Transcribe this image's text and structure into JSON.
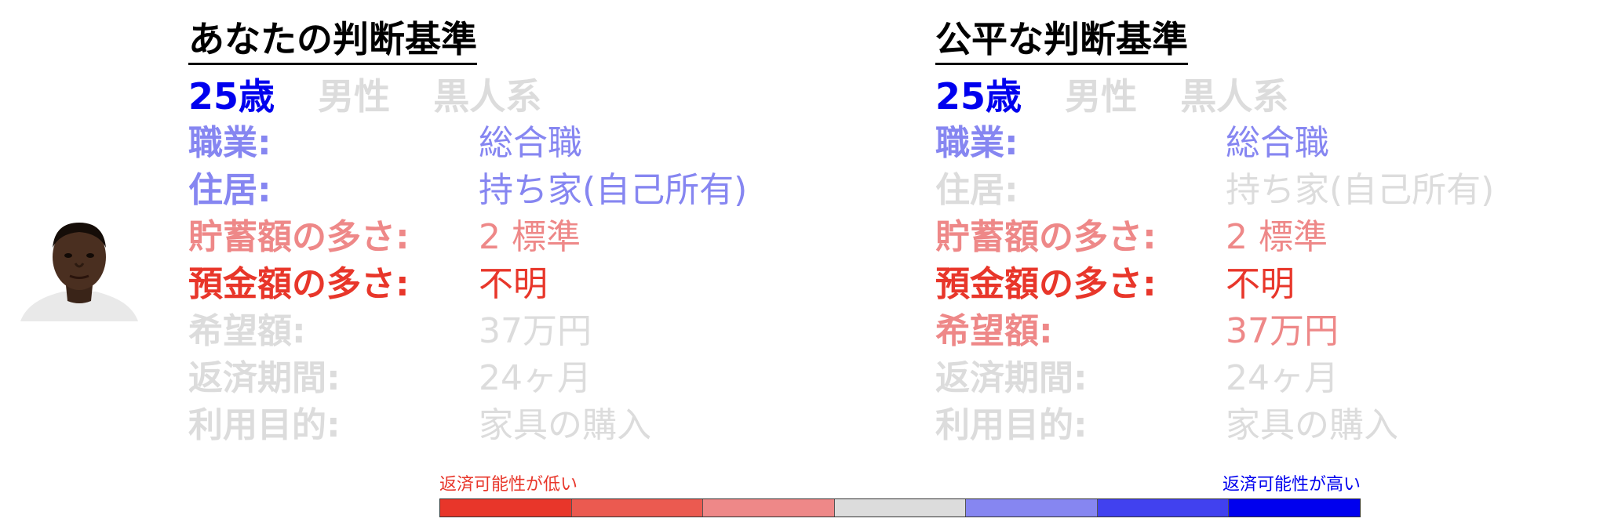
{
  "colors": {
    "level_high": "#0000ee",
    "level_mid_high": "#8686f1",
    "neutral": "#dcdcdc",
    "level_low_mid": "#ee8888",
    "level_low": "#e8362a",
    "heading": "#000000"
  },
  "avatar_icon": "person-photo-icon",
  "panels": [
    {
      "heading": "あなたの判断基準",
      "demographics": [
        {
          "text": "25歳",
          "color": "#0000ee"
        },
        {
          "text": "男性",
          "color": "#dcdcdc"
        },
        {
          "text": "黒人系",
          "color": "#dcdcdc"
        }
      ],
      "rows": [
        {
          "label": "職業:",
          "value": "総合職",
          "color": "#8686f1"
        },
        {
          "label": "住居:",
          "value": "持ち家(自己所有)",
          "color": "#8686f1"
        },
        {
          "label": "貯蓄額の多さ:",
          "value": "2 標準",
          "color": "#ee8888"
        },
        {
          "label": "預金額の多さ:",
          "value": "不明",
          "color": "#e8362a"
        },
        {
          "label": "希望額:",
          "value": "37万円",
          "color": "#dcdcdc"
        },
        {
          "label": "返済期間:",
          "value": "24ヶ月",
          "color": "#dcdcdc"
        },
        {
          "label": "利用目的:",
          "value": "家具の購入",
          "color": "#dcdcdc"
        }
      ]
    },
    {
      "heading": "公平な判断基準",
      "demographics": [
        {
          "text": "25歳",
          "color": "#0000ee"
        },
        {
          "text": "男性",
          "color": "#dcdcdc"
        },
        {
          "text": "黒人系",
          "color": "#dcdcdc"
        }
      ],
      "rows": [
        {
          "label": "職業:",
          "value": "総合職",
          "color": "#8686f1"
        },
        {
          "label": "住居:",
          "value": "持ち家(自己所有)",
          "color": "#dcdcdc"
        },
        {
          "label": "貯蓄額の多さ:",
          "value": "2 標準",
          "color": "#ee8888"
        },
        {
          "label": "預金額の多さ:",
          "value": "不明",
          "color": "#e8362a"
        },
        {
          "label": "希望額:",
          "value": "37万円",
          "color": "#ee8888"
        },
        {
          "label": "返済期間:",
          "value": "24ヶ月",
          "color": "#dcdcdc"
        },
        {
          "label": "利用目的:",
          "value": "家具の購入",
          "color": "#dcdcdc"
        }
      ]
    }
  ],
  "legend": {
    "low_label": "返済可能性が低い",
    "high_label": "返済可能性が高い",
    "low_color": "#e8362a",
    "high_color": "#0000ee",
    "segments": [
      "#e8362a",
      "#eb5a50",
      "#ee8888",
      "#dcdcdc",
      "#8686f1",
      "#4141ef",
      "#0000ee"
    ]
  }
}
